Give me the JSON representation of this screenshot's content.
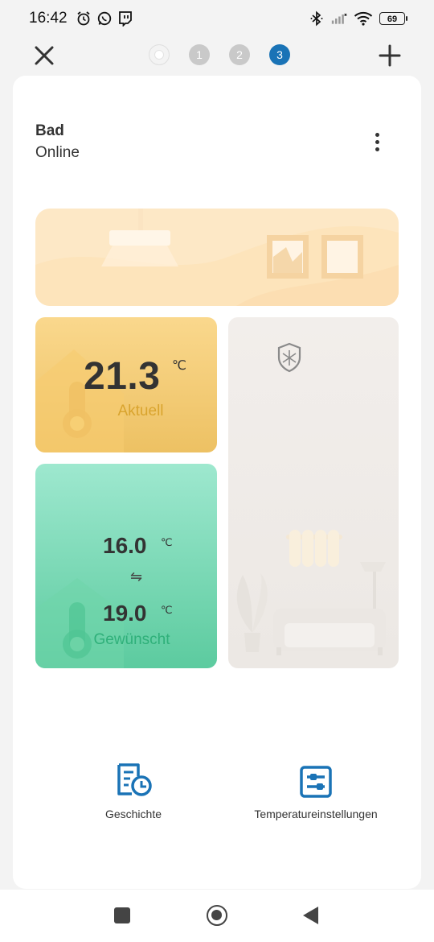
{
  "status_bar": {
    "time": "16:42",
    "battery": "69",
    "icons": [
      "alarm-icon",
      "whatsapp-icon",
      "twitch-icon",
      "bluetooth-icon",
      "signal-icon",
      "wifi-icon",
      "battery-icon"
    ]
  },
  "nav": {
    "pages": [
      "",
      "1",
      "2",
      "3"
    ],
    "active_page": "3",
    "close_icon": "close-icon",
    "add_icon": "plus-icon"
  },
  "device": {
    "name": "Bad",
    "status": "Online"
  },
  "current": {
    "value": "21.3",
    "unit": "℃",
    "label": "Aktuell"
  },
  "target": {
    "low": "16.0",
    "high": "19.0",
    "unit": "℃",
    "swap": "⇋",
    "label": "Gewünscht"
  },
  "actions": {
    "history_label": "Geschichte",
    "settings_label": "Temperatureinstellungen"
  },
  "colors": {
    "accent": "#1a73b6",
    "current_tile": "#f5cd73",
    "target_tile": "#7dd9b5",
    "target_label": "#2fb07a",
    "current_label": "#d9a42e"
  }
}
